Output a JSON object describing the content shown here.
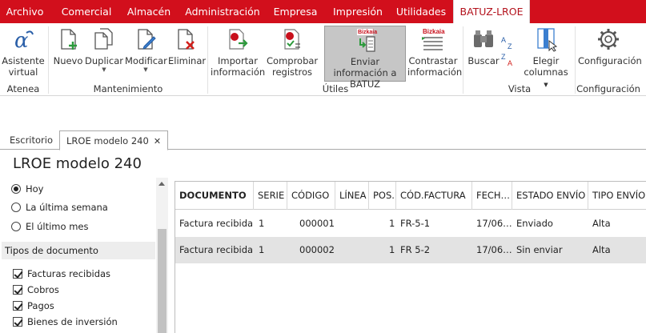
{
  "tabs": [
    "Archivo",
    "Comercial",
    "Almacén",
    "Administración",
    "Empresa",
    "Impresión",
    "Utilidades",
    "BATUZ-LROE"
  ],
  "ribbon": {
    "asistente": "Asistente virtual",
    "atenea": "Atenea",
    "nuevo": "Nuevo",
    "duplicar": "Duplicar",
    "modificar": "Modificar",
    "eliminar": "Eliminar",
    "mantenimiento": "Mantenimiento",
    "importar": "Importar información",
    "comprobar": "Comprobar registros",
    "enviar": "Enviar información a BATUZ",
    "contrastar": "Contrastar información",
    "utiles": "Útiles",
    "buscar": "Buscar",
    "elegir": "Elegir columnas",
    "vista": "Vista",
    "configuracion_btn": "Configuración",
    "configuracion_group": "Configuración",
    "logo_text": "Bizkaia",
    "logo_sub": "foru"
  },
  "doctabs": {
    "escritorio": "Escritorio",
    "lroe": "LROE modelo 240",
    "close": "✕"
  },
  "page_title": "LROE modelo 240",
  "filters": {
    "hoy": "Hoy",
    "semana": "La última semana",
    "mes": "El último mes"
  },
  "tipos": {
    "header": "Tipos de documento",
    "items": [
      "Facturas recibidas",
      "Cobros",
      "Pagos",
      "Bienes de inversión"
    ]
  },
  "grid": {
    "columns": [
      "DOCUMENTO",
      "SERIE",
      "CÓDIGO",
      "LÍNEA",
      "POS.",
      "CÓD.FACTURA",
      "FECH…",
      "ESTADO ENVÍO",
      "TIPO ENVÍO"
    ],
    "rows": [
      [
        "Factura recibida",
        "1",
        "000001",
        "",
        "1",
        "FR-5-1",
        "17/06…",
        "Enviado",
        "Alta"
      ],
      [
        "Factura recibida",
        "1",
        "000002",
        "",
        "1",
        "FR 5-2",
        "17/06…",
        "Sin enviar",
        "Alta"
      ]
    ]
  },
  "colors": {
    "brand_red": "#d20f1c",
    "selected_row": "#e3e3e3"
  }
}
